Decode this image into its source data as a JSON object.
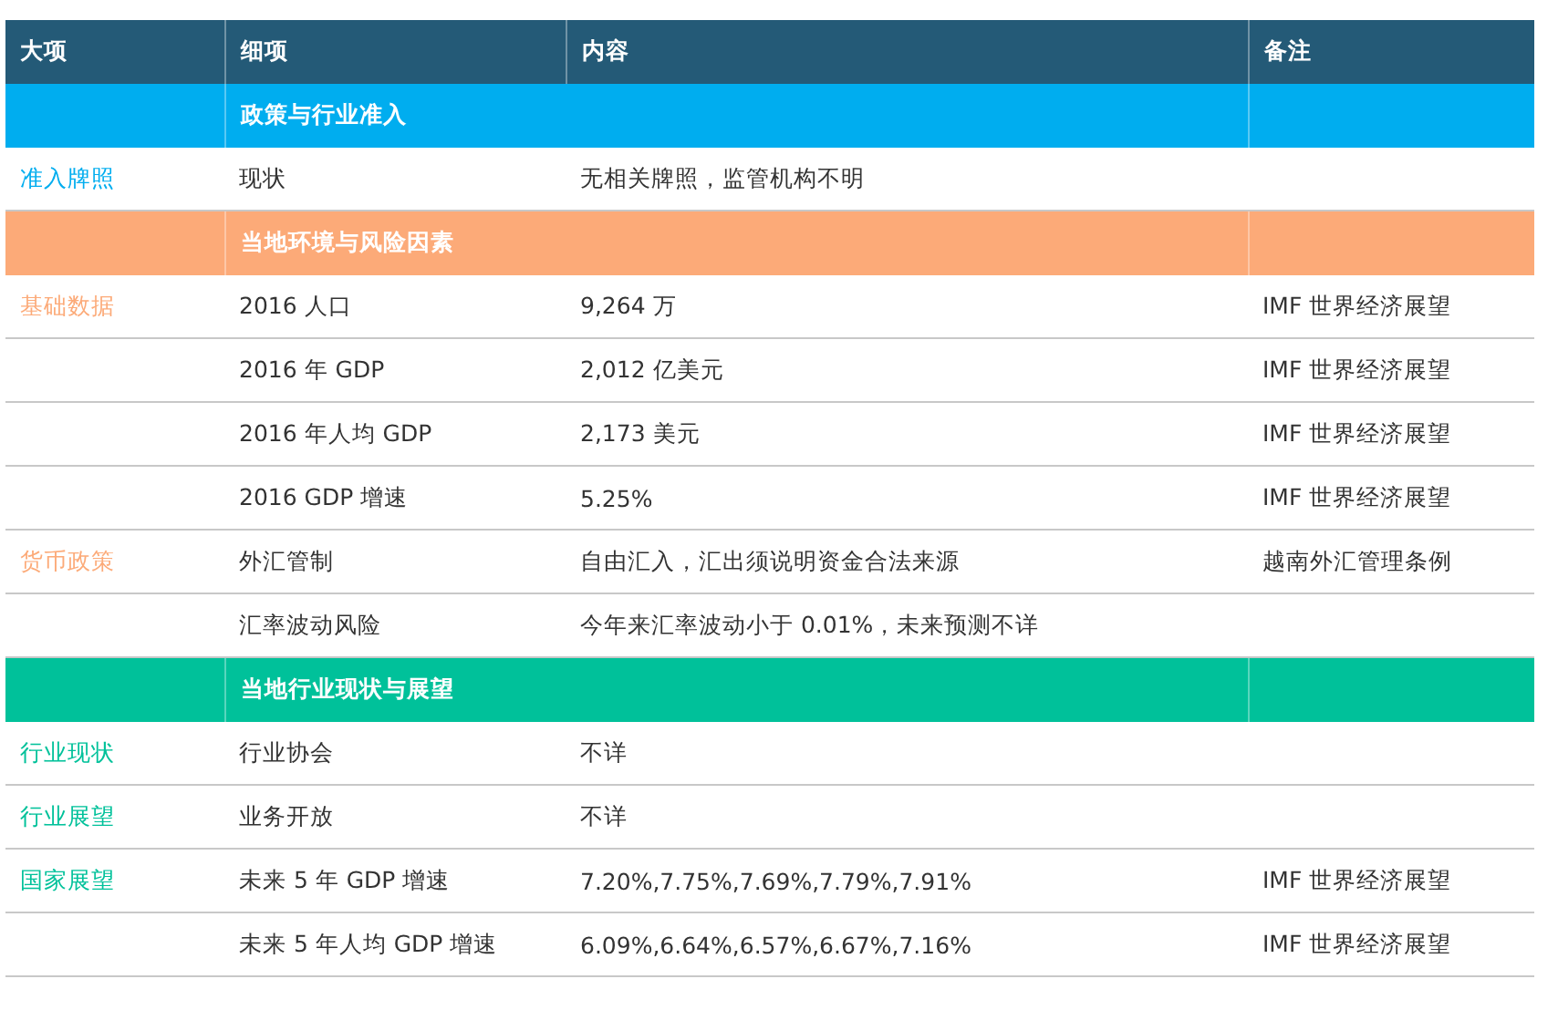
{
  "table": {
    "columns": [
      "大项",
      "细项",
      "内容",
      "备注"
    ],
    "sections": [
      {
        "title": "政策与行业准入",
        "color": "#00adef",
        "rows": [
          {
            "category": "准入牌照",
            "item": "现状",
            "content": "无相关牌照，监管机构不明"
          }
        ]
      },
      {
        "title": "当地环境与风险因素",
        "color": "#fcaa78",
        "rows": [
          {
            "category": "基础数据",
            "item": "2016 人口",
            "content": "9,264 万",
            "note": "IMF 世界经济展望"
          },
          {
            "item": "2016 年 GDP",
            "content": "2,012 亿美元",
            "note": "IMF 世界经济展望"
          },
          {
            "item": "2016 年人均 GDP",
            "content": "2,173 美元",
            "note": "IMF 世界经济展望"
          },
          {
            "item": "2016 GDP 增速",
            "content": "5.25%",
            "note": "IMF 世界经济展望"
          },
          {
            "category": "货币政策",
            "item": "外汇管制",
            "content": "自由汇入，汇出须说明资金合法来源",
            "note": "越南外汇管理条例"
          },
          {
            "item": "汇率波动风险",
            "content": "今年来汇率波动小于 0.01%，未来预测不详"
          }
        ]
      },
      {
        "title": "当地行业现状与展望",
        "color": "#00c19a",
        "rows": [
          {
            "category": "行业现状",
            "item": "行业协会",
            "content": "不详"
          },
          {
            "category": "行业展望",
            "item": "业务开放",
            "content": "不详"
          },
          {
            "category": "国家展望",
            "item": "未来 5 年 GDP 增速",
            "content": "7.20%,7.75%,7.69%,7.79%,7.91%",
            "note": "IMF 世界经济展望"
          },
          {
            "item": "未来 5 年人均 GDP 增速",
            "content": "6.09%,6.64%,6.57%,6.67%,7.16%",
            "note": "IMF 世界经济展望"
          }
        ]
      }
    ]
  }
}
